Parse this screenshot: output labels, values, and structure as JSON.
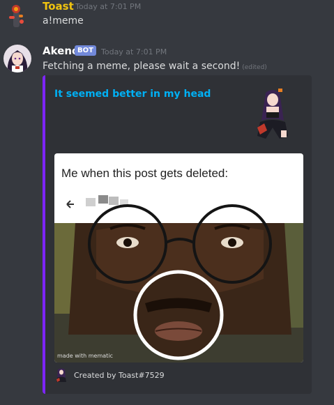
{
  "messages": [
    {
      "author": "Toast",
      "timestamp": "Today at 7:01 PM",
      "text": "a!meme",
      "author_color": "#f1c40f"
    },
    {
      "author": "Akeno",
      "badge": "BOT",
      "timestamp": "Today at 7:01 PM",
      "text": "Fetching a meme, please wait a second!",
      "edited_label": "(edited)",
      "author_color": "#ffffff",
      "embed": {
        "title": "It seemed better in my head",
        "accent_color": "#7d25ff",
        "image": {
          "caption": "Me when this post gets deleted:",
          "watermark": "made with mematic"
        },
        "footer": "Created by Toast#7529"
      }
    }
  ],
  "colors": {
    "background": "#36393f",
    "embed_background": "#2f3136",
    "link": "#00b0f4",
    "bot_badge": "#7289da"
  }
}
